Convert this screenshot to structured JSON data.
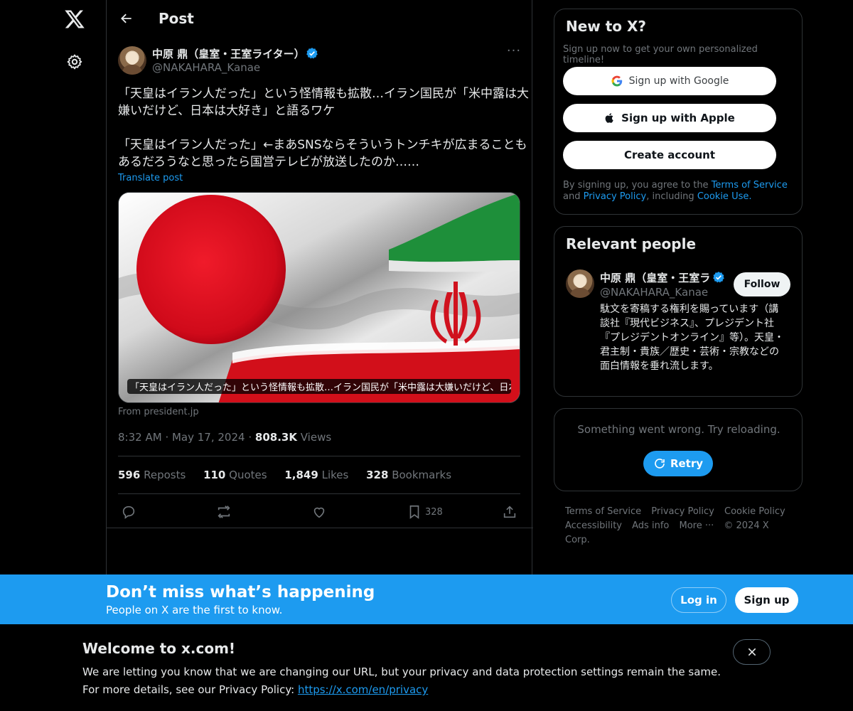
{
  "nav": {
    "logo_icon": "x-logo-icon",
    "settings_icon": "gear-icon"
  },
  "header": {
    "title": "Post"
  },
  "post": {
    "author_name": "中原 鼎（皇室・王室ライター）",
    "author_handle": "@NAKAHARA_Kanae",
    "text_line1": "「天皇はイラン人だった」という怪情報も拡散…イラン国民が「米中露は大",
    "text_line2": "嫌いだけど、日本は大好き」と語るワケ",
    "text_line3": "「天皇はイラン人だった」←まあSNSならそういうトンチキが広まることも",
    "text_line4": "あるだろうなと思ったら国営テレビが放送したのか……",
    "translate": "Translate post",
    "card_caption": "「天皇はイラン人だった」という怪情報も拡散…イラン国民が「米中露は大嫌いだけど、日本...",
    "from": "From president.jp",
    "time": "8:32 AM",
    "date": "May 17, 2024",
    "views_count": "808.3K",
    "views_label": "Views",
    "reposts_count": "596",
    "reposts_label": "Reposts",
    "quotes_count": "110",
    "quotes_label": "Quotes",
    "likes_count": "1,849",
    "likes_label": "Likes",
    "bookmarks_count": "328",
    "bookmarks_label": "Bookmarks",
    "bookmark_action_count": "328"
  },
  "signup_panel": {
    "title": "New to X?",
    "subtitle": "Sign up now to get your own personalized timeline!",
    "google": "Sign up with Google",
    "apple": "Sign up with Apple",
    "create": "Create account",
    "legal_prefix": "By signing up, you agree to the ",
    "terms": "Terms of Service",
    "and": " and ",
    "privacy": "Privacy Policy",
    "including": ", including ",
    "cookie": "Cookie Use."
  },
  "relevant": {
    "title": "Relevant people",
    "name": "中原 鼎（皇室・王室ラ",
    "handle": "@NAKAHARA_Kanae",
    "follow": "Follow",
    "bio": "駄文を寄稿する権利を賜っています（講談社『現代ビジネス』、プレジデント社『プレジデントオンライン』等）。天皇・君主制・貴族／歴史・芸術・宗教などの面白情報を垂れ流します。"
  },
  "error_panel": {
    "message": "Something went wrong. Try reloading.",
    "retry": "Retry"
  },
  "footer": {
    "terms": "Terms of Service",
    "privacy": "Privacy Policy",
    "cookie": "Cookie Policy",
    "accessibility": "Accessibility",
    "ads": "Ads info",
    "more": "More ···",
    "copyright": "© 2024 X Corp."
  },
  "bluebar": {
    "title": "Don’t miss what’s happening",
    "subtitle": "People on X are the first to know.",
    "login": "Log in",
    "signup": "Sign up"
  },
  "welcome": {
    "title": "Welcome to x.com!",
    "line1": "We are letting you know that we are changing our URL, but your privacy and data protection settings remain the same.",
    "line2_prefix": "For more details, see our Privacy Policy: ",
    "line2_link": "https://x.com/en/privacy"
  },
  "colors": {
    "accent": "#1d9bf0",
    "bg": "#000000",
    "text": "#e7e9ea",
    "muted": "#71767b",
    "border": "#2f3336"
  }
}
